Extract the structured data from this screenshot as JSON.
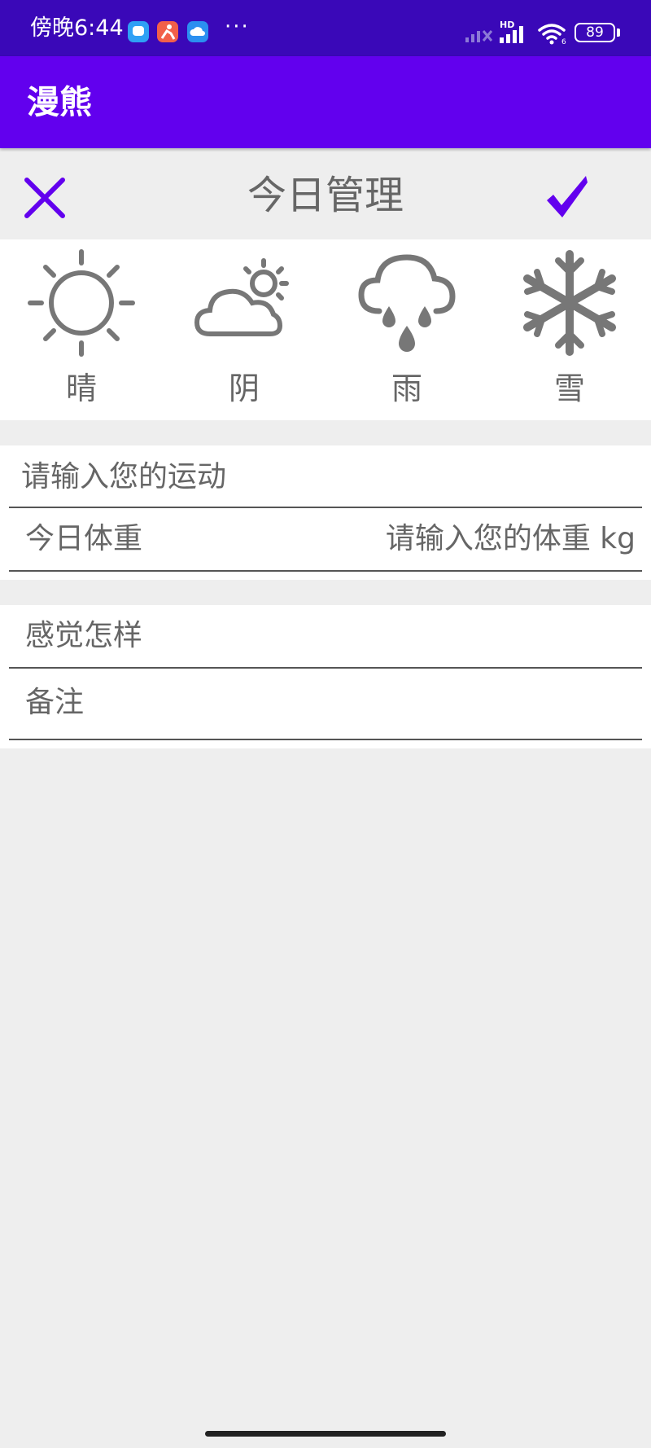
{
  "status_bar": {
    "time": "傍晚6:44",
    "more": "···",
    "network": "HD",
    "battery": "89",
    "app_icons": [
      "chat-app-icon",
      "person-app-icon",
      "cloud-app-icon"
    ]
  },
  "app_bar": {
    "title": "漫熊"
  },
  "header": {
    "title": "今日管理",
    "close_icon": "close-icon",
    "confirm_icon": "checkmark-icon"
  },
  "weather_options": [
    {
      "label": "晴",
      "icon": "sun-icon"
    },
    {
      "label": "阴",
      "icon": "cloudy-icon"
    },
    {
      "label": "雨",
      "icon": "rain-icon"
    },
    {
      "label": "雪",
      "icon": "snow-icon"
    }
  ],
  "form": {
    "exercise_placeholder": "请输入您的运动",
    "weight_label": "今日体重",
    "weight_placeholder": "请输入您的体重 kg",
    "feeling_placeholder": "感觉怎样",
    "notes_placeholder": "备注"
  },
  "colors": {
    "status_bar": "#3a08b8",
    "primary": "#6200ee",
    "icon_gray": "#777777",
    "text_gray": "#666666",
    "background": "#eeeeee"
  }
}
